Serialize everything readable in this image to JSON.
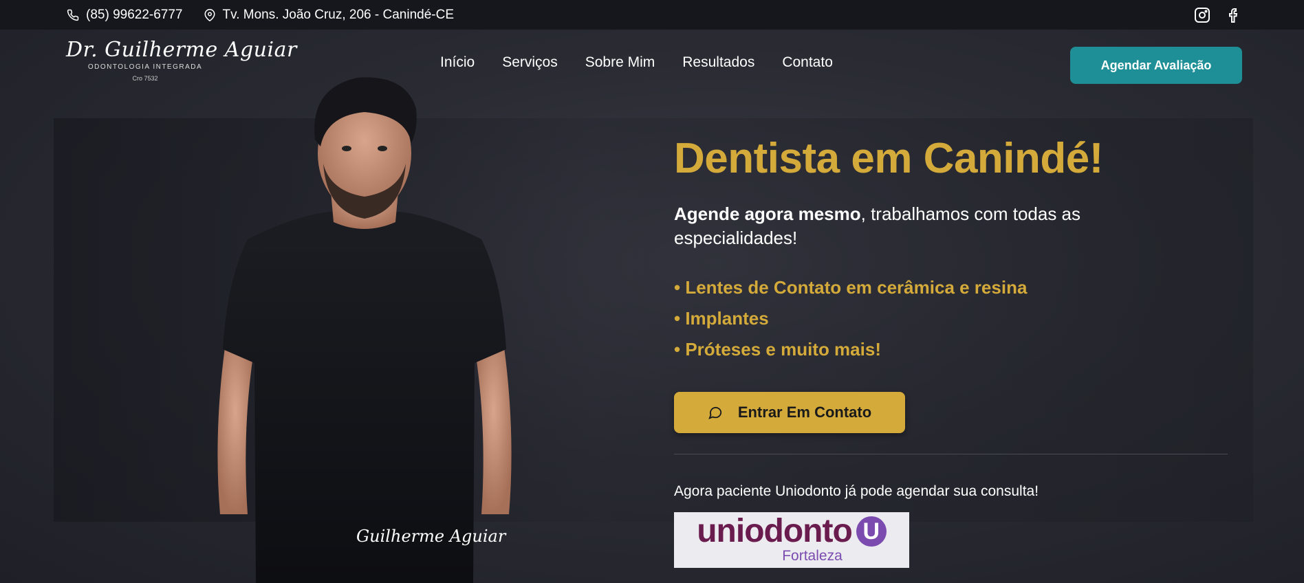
{
  "topbar": {
    "phone": "(85) 99622-6777",
    "address": "Tv. Mons. João Cruz, 206 - Canindé-CE",
    "social": [
      "instagram-icon",
      "facebook-icon"
    ]
  },
  "header": {
    "logo": {
      "name": "Dr. Guilherme Aguiar",
      "subtitle": "ODONTOLOGIA INTEGRADA",
      "cro": "Cro 7532"
    },
    "nav": [
      "Início",
      "Serviços",
      "Sobre Mim",
      "Resultados",
      "Contato"
    ],
    "cta": "Agendar Avaliação"
  },
  "hero": {
    "title": "Dentista em Canindé!",
    "lead_bold": "Agende agora mesmo",
    "lead_rest": ", trabalhamos com todas as especialidades!",
    "features": [
      "• Lentes de Contato em cerâmica e resina",
      "• Implantes",
      "• Próteses e muito mais!"
    ],
    "cta": "Entrar Em Contato",
    "signature": "Guilherme Aguiar",
    "uniodonto_text": "Agora paciente Uniodonto já pode agendar sua consulta!",
    "uniodonto_logo": {
      "word": "uniodonto",
      "mark": "U",
      "city": "Fortaleza"
    }
  },
  "colors": {
    "accent_gold": "#d4aa3a",
    "accent_teal": "#1f8f97",
    "topbar_bg": "#16171c"
  }
}
